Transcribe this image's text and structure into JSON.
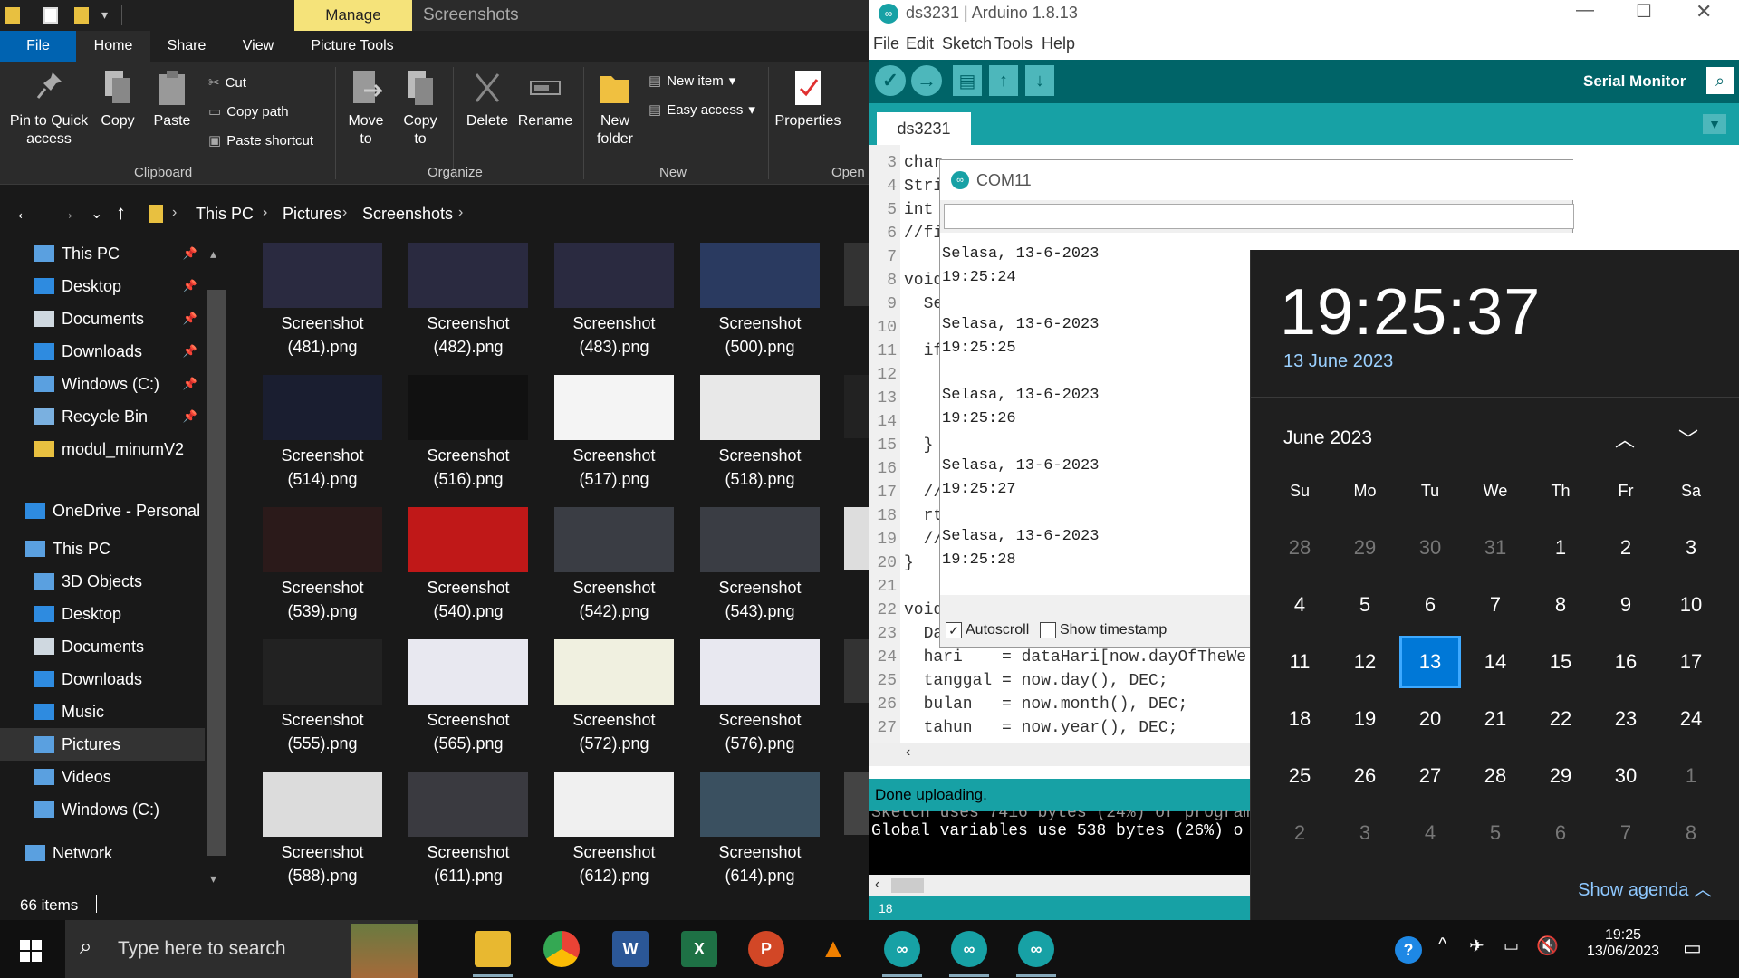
{
  "explorer": {
    "title_tabs": {
      "manage": "Manage",
      "screenshots": "Screenshots"
    },
    "menu_tabs": [
      "File",
      "Home",
      "Share",
      "View",
      "Picture Tools"
    ],
    "ribbon": {
      "pin": "Pin to Quick access",
      "copy": "Copy",
      "paste": "Paste",
      "cut": "Cut",
      "copy_path": "Copy path",
      "paste_shortcut": "Paste shortcut",
      "move_to": "Move to",
      "copy_to": "Copy to",
      "delete": "Delete",
      "rename": "Rename",
      "new_folder": "New folder",
      "new_item": "New item",
      "easy_access": "Easy access",
      "properties": "Properties",
      "groups": {
        "clipboard": "Clipboard",
        "organize": "Organize",
        "new": "New",
        "open": "Open"
      }
    },
    "breadcrumb": [
      "This PC",
      "Pictures",
      "Screenshots"
    ],
    "nav": [
      {
        "label": "This PC",
        "pinned": true
      },
      {
        "label": "Desktop",
        "pinned": true
      },
      {
        "label": "Documents",
        "pinned": true
      },
      {
        "label": "Downloads",
        "pinned": true
      },
      {
        "label": "Windows (C:)",
        "pinned": true
      },
      {
        "label": "Recycle Bin",
        "pinned": true
      },
      {
        "label": "modul_minumV2",
        "pinned": false
      },
      {
        "label": "OneDrive - Personal",
        "pinned": false
      },
      {
        "label": "This PC",
        "pinned": false
      },
      {
        "label": "3D Objects",
        "pinned": false
      },
      {
        "label": "Desktop",
        "pinned": false
      },
      {
        "label": "Documents",
        "pinned": false
      },
      {
        "label": "Downloads",
        "pinned": false
      },
      {
        "label": "Music",
        "pinned": false
      },
      {
        "label": "Pictures",
        "pinned": false
      },
      {
        "label": "Videos",
        "pinned": false
      },
      {
        "label": "Windows (C:)",
        "pinned": false
      },
      {
        "label": "Network",
        "pinned": false
      }
    ],
    "files": [
      {
        "name": "Screenshot",
        "num": "(481).png"
      },
      {
        "name": "Screenshot",
        "num": "(482).png"
      },
      {
        "name": "Screenshot",
        "num": "(483).png"
      },
      {
        "name": "Screenshot",
        "num": "(500).png"
      },
      {
        "name": "Screenshot",
        "num": "(514).png"
      },
      {
        "name": "Screenshot",
        "num": "(516).png"
      },
      {
        "name": "Screenshot",
        "num": "(517).png"
      },
      {
        "name": "Screenshot",
        "num": "(518).png"
      },
      {
        "name": "Screenshot",
        "num": "(539).png"
      },
      {
        "name": "Screenshot",
        "num": "(540).png"
      },
      {
        "name": "Screenshot",
        "num": "(542).png"
      },
      {
        "name": "Screenshot",
        "num": "(543).png"
      },
      {
        "name": "Screenshot",
        "num": "(555).png"
      },
      {
        "name": "Screenshot",
        "num": "(565).png"
      },
      {
        "name": "Screenshot",
        "num": "(572).png"
      },
      {
        "name": "Screenshot",
        "num": "(576).png"
      },
      {
        "name": "Screenshot",
        "num": "(588).png"
      },
      {
        "name": "Screenshot",
        "num": "(611).png"
      },
      {
        "name": "Screenshot",
        "num": "(612).png"
      },
      {
        "name": "Screenshot",
        "num": "(614).png"
      }
    ],
    "status": "66 items"
  },
  "arduino": {
    "title": "ds3231 | Arduino 1.8.13",
    "menu": [
      "File",
      "Edit",
      "Sketch",
      "Tools",
      "Help"
    ],
    "serial_monitor_label": "Serial Monitor",
    "tab": "ds3231",
    "code_lines": [
      {
        "n": "3",
        "text": "char"
      },
      {
        "n": "4",
        "text": "Stri"
      },
      {
        "n": "5",
        "text": "int"
      },
      {
        "n": "6",
        "text": "//fi"
      },
      {
        "n": "7",
        "text": ""
      },
      {
        "n": "8",
        "text": "void"
      },
      {
        "n": "9",
        "text": "  Se"
      },
      {
        "n": "10",
        "text": ""
      },
      {
        "n": "11",
        "text": "  if"
      },
      {
        "n": "12",
        "text": ""
      },
      {
        "n": "13",
        "text": ""
      },
      {
        "n": "14",
        "text": ""
      },
      {
        "n": "15",
        "text": "  }"
      },
      {
        "n": "16",
        "text": ""
      },
      {
        "n": "17",
        "text": "  //"
      },
      {
        "n": "18",
        "text": "  rt"
      },
      {
        "n": "19",
        "text": "  //"
      },
      {
        "n": "20",
        "text": "}"
      },
      {
        "n": "21",
        "text": ""
      },
      {
        "n": "22",
        "text": "void"
      },
      {
        "n": "23",
        "text": "  Da"
      },
      {
        "n": "24",
        "text": "  hari    = dataHari[now.dayOfTheWe"
      },
      {
        "n": "25",
        "text": "  tanggal = now.day(), DEC;"
      },
      {
        "n": "26",
        "text": "  bulan   = now.month(), DEC;"
      },
      {
        "n": "27",
        "text": "  tahun   = now.year(), DEC;"
      }
    ],
    "console_head": "Done uploading.",
    "console_line": "Global variables use 538 bytes (26%) o",
    "status_line": "18"
  },
  "serial": {
    "title": "COM11",
    "lines": [
      "Selasa, 13-6-2023",
      "19:25:24",
      "",
      "Selasa, 13-6-2023",
      "19:25:25",
      "",
      "Selasa, 13-6-2023",
      "19:25:26",
      "",
      "Selasa, 13-6-2023",
      "19:25:27",
      "",
      "Selasa, 13-6-2023",
      "19:25:28"
    ],
    "autoscroll": "Autoscroll",
    "autoscroll_checked": true,
    "timestamp": "Show timestamp",
    "timestamp_checked": false
  },
  "calendar": {
    "time": "19:25:37",
    "date": "13 June 2023",
    "month": "June 2023",
    "dows": [
      "Su",
      "Mo",
      "Tu",
      "We",
      "Th",
      "Fr",
      "Sa"
    ],
    "weeks": [
      [
        "28",
        "29",
        "30",
        "31",
        "1",
        "2",
        "3"
      ],
      [
        "4",
        "5",
        "6",
        "7",
        "8",
        "9",
        "10"
      ],
      [
        "11",
        "12",
        "13",
        "14",
        "15",
        "16",
        "17"
      ],
      [
        "18",
        "19",
        "20",
        "21",
        "22",
        "23",
        "24"
      ],
      [
        "25",
        "26",
        "27",
        "28",
        "29",
        "30",
        "1"
      ],
      [
        "2",
        "3",
        "4",
        "5",
        "6",
        "7",
        "8"
      ]
    ],
    "today": "13",
    "show_agenda": "Show agenda"
  },
  "taskbar": {
    "search_placeholder": "Type here to search",
    "clock_time": "19:25",
    "clock_date": "13/06/2023"
  }
}
